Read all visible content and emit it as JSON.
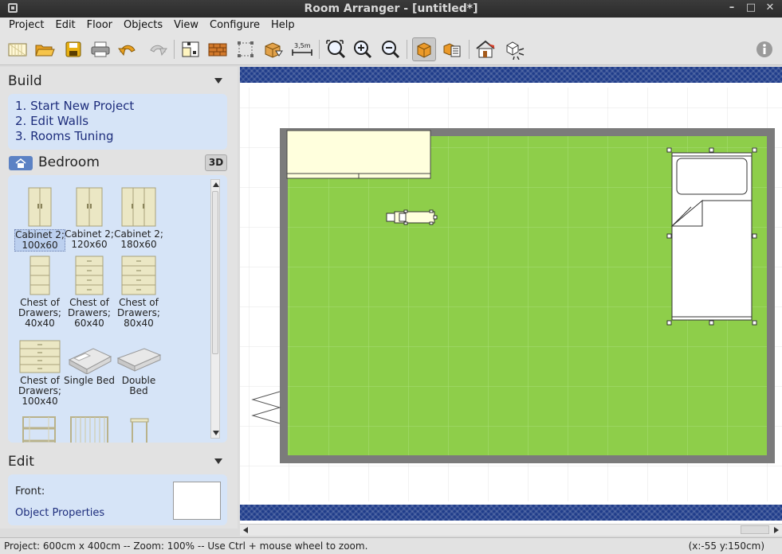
{
  "window": {
    "title": "Room Arranger - [untitled*]"
  },
  "menu": [
    "Project",
    "Edit",
    "Floor",
    "Objects",
    "View",
    "Configure",
    "Help"
  ],
  "toolbar": {
    "icons": [
      "new-project-icon",
      "open-icon",
      "save-icon",
      "print-icon",
      "undo-icon",
      "redo-icon",
      "edit-walls-icon",
      "floor-texture-icon",
      "select-icon",
      "add-object-icon",
      "measure-icon",
      "zoom-fit-icon",
      "zoom-in-icon",
      "zoom-out-icon",
      "view-2d-icon",
      "view-layers-icon",
      "view-3d-house-icon",
      "render-icon",
      "info-icon"
    ],
    "measure_label": "3,5m"
  },
  "build": {
    "title": "Build",
    "steps": [
      "1. Start New Project",
      "2. Edit Walls",
      "3. Rooms Tuning"
    ]
  },
  "category": {
    "name": "Bedroom",
    "btn_3d": "3D"
  },
  "catalog": [
    {
      "label": "Cabinet 2; 100x60",
      "selected": true
    },
    {
      "label": "Cabinet 2; 120x60"
    },
    {
      "label": "Cabinet 2; 180x60"
    },
    {
      "label": "Chest of Drawers; 40x40"
    },
    {
      "label": "Chest of Drawers; 60x40"
    },
    {
      "label": "Chest of Drawers; 80x40"
    },
    {
      "label": "Chest of Drawers; 100x40"
    },
    {
      "label": "Single Bed"
    },
    {
      "label": "Double Bed"
    }
  ],
  "edit": {
    "title": "Edit",
    "front_label": "Front:",
    "properties_link": "Object Properties"
  },
  "status": {
    "left": "Project: 600cm x 400cm -- Zoom: 100% -- Use Ctrl + mouse wheel to zoom.",
    "right": "(x:-55 y:150cm)"
  },
  "colors": {
    "floor": "#8ece4a",
    "wall": "#7b7b7b",
    "ruler": "#1f3c8a",
    "panel": "#d6e4f7",
    "link": "#1d2d7c"
  }
}
